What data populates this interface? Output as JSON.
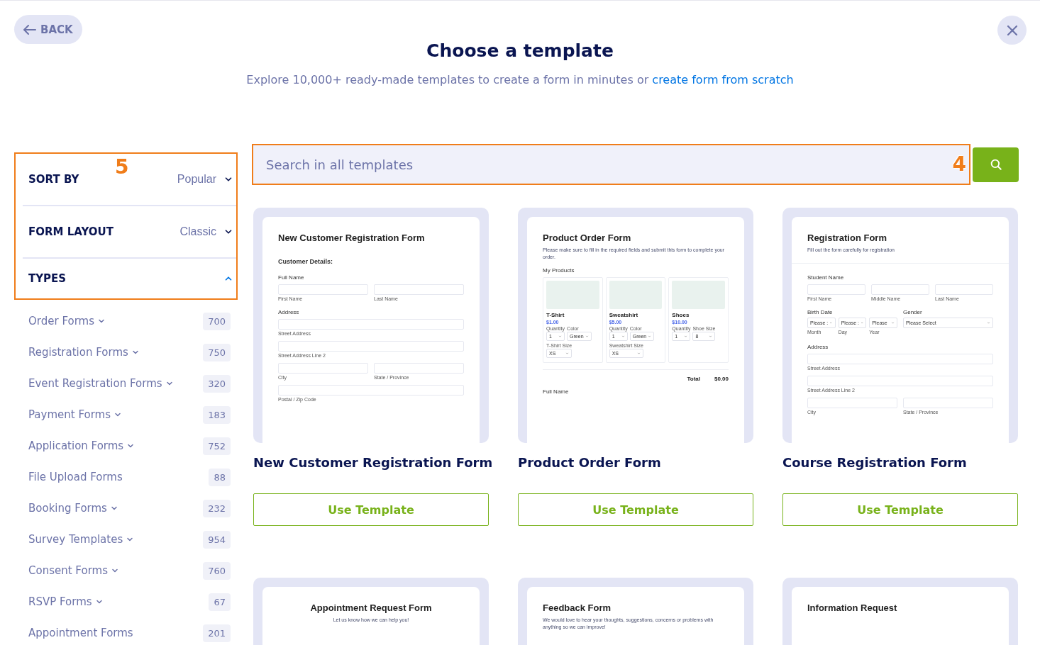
{
  "header": {
    "back_button": "BACK",
    "title": "Choose a template",
    "subtitle": "Explore 10,000+ ready-made templates to create a form in minutes or",
    "subtitle_link": "create form from scratch"
  },
  "filters": {
    "callout": "5",
    "sort_by": {
      "label": "SORT BY",
      "value": "Popular",
      "expanded": false
    },
    "form_layout": {
      "label": "FORM LAYOUT",
      "value": "Classic",
      "expanded": false
    },
    "types": {
      "label": "TYPES",
      "expanded": true
    },
    "categories": [
      {
        "name": "Order Forms",
        "count": "700",
        "has_submenu": true
      },
      {
        "name": "Registration Forms",
        "count": "750",
        "has_submenu": true
      },
      {
        "name": "Event Registration Forms",
        "count": "320",
        "has_submenu": true
      },
      {
        "name": "Payment Forms",
        "count": "183",
        "has_submenu": true
      },
      {
        "name": "Application Forms",
        "count": "752",
        "has_submenu": true
      },
      {
        "name": "File Upload Forms",
        "count": "88",
        "has_submenu": false
      },
      {
        "name": "Booking Forms",
        "count": "232",
        "has_submenu": true
      },
      {
        "name": "Survey Templates",
        "count": "954",
        "has_submenu": true
      },
      {
        "name": "Consent Forms",
        "count": "760",
        "has_submenu": true
      },
      {
        "name": "RSVP Forms",
        "count": "67",
        "has_submenu": true
      },
      {
        "name": "Appointment Forms",
        "count": "201",
        "has_submenu": false
      }
    ]
  },
  "search": {
    "placeholder": "Search in all templates",
    "callout": "4"
  },
  "templates": [
    {
      "name": "New Customer Registration Form",
      "button": "Use Template",
      "preview": [
        {
          "kind": "title",
          "text": "New Customer Registration Form"
        },
        {
          "kind": "section",
          "text": "Customer Details:"
        },
        {
          "kind": "label",
          "text": "Full Name"
        },
        {
          "kind": "fields",
          "subs": [
            "First Name",
            "Last Name"
          ]
        },
        {
          "kind": "label",
          "text": "Address"
        },
        {
          "kind": "fields",
          "subs": [
            "Street Address"
          ]
        },
        {
          "kind": "fields",
          "subs": [
            "Street Address Line 2"
          ]
        },
        {
          "kind": "fields",
          "subs": [
            "City",
            "State / Province"
          ]
        },
        {
          "kind": "fields",
          "subs": [
            "Postal / Zip Code"
          ]
        }
      ]
    },
    {
      "name": "Product Order Form",
      "button": "Use Template",
      "preview": [
        {
          "kind": "title",
          "text": "Product Order Form"
        },
        {
          "kind": "description",
          "text": "Please make sure to fill in the required fields and submit this form to complete your order."
        },
        {
          "kind": "label",
          "text": "My Products"
        },
        {
          "kind": "products",
          "items": [
            {
              "name": "T-Shirt",
              "price": "$1.00",
              "options": [
                {
                  "label": "Quantity",
                  "value": "1"
                },
                {
                  "label": "Color",
                  "value": "Green"
                },
                {
                  "label": "T-Shirt Size",
                  "value": "XS"
                }
              ]
            },
            {
              "name": "Sweatshirt",
              "price": "$5.00",
              "options": [
                {
                  "label": "Quantity",
                  "value": "1"
                },
                {
                  "label": "Color",
                  "value": "Green"
                },
                {
                  "label": "Sweatshirt Size",
                  "value": "XS"
                }
              ]
            },
            {
              "name": "Shoes",
              "price": "$10.00",
              "options": [
                {
                  "label": "Quantity",
                  "value": "1"
                },
                {
                  "label": "Shoe Size",
                  "value": "8"
                }
              ]
            }
          ]
        },
        {
          "kind": "total",
          "label": "Total",
          "value": "$0.00"
        },
        {
          "kind": "label",
          "text": "Full Name"
        }
      ]
    },
    {
      "name": "Course Registration Form",
      "button": "Use Template",
      "preview": [
        {
          "kind": "title",
          "text": "Registration Form"
        },
        {
          "kind": "description",
          "text": "Fill out the form carefully for registration"
        },
        {
          "kind": "divider"
        },
        {
          "kind": "label",
          "text": "Student Name"
        },
        {
          "kind": "fields",
          "subs": [
            "First Name",
            "Middle Name",
            "Last Name"
          ]
        },
        {
          "kind": "select_groups",
          "groups": [
            {
              "label": "Birth Date",
              "selects": [
                {
                  "value": "Please :",
                  "sub": "Month"
                },
                {
                  "value": "Please :",
                  "sub": "Day"
                },
                {
                  "value": "Please",
                  "sub": "Year"
                }
              ]
            },
            {
              "label": "Gender",
              "selects": [
                {
                  "value": "Please Select"
                }
              ]
            }
          ]
        },
        {
          "kind": "label",
          "text": "Address"
        },
        {
          "kind": "fields",
          "subs": [
            "Street Address"
          ]
        },
        {
          "kind": "fields",
          "subs": [
            "Street Address Line 2"
          ]
        },
        {
          "kind": "fields",
          "subs": [
            "City",
            "State / Province"
          ]
        }
      ]
    },
    {
      "preview": [
        {
          "kind": "centered_title",
          "text": "Appointment Request Form"
        },
        {
          "kind": "centered_description",
          "text": "Let us know how we can help you!"
        }
      ]
    },
    {
      "preview": [
        {
          "kind": "title",
          "text": "Feedback Form"
        },
        {
          "kind": "description",
          "text": "We would love to hear your thoughts, suggestions, concerns or problems with anything so we can improve!"
        }
      ]
    },
    {
      "preview": [
        {
          "kind": "title",
          "text": "Information Request"
        }
      ]
    }
  ]
}
